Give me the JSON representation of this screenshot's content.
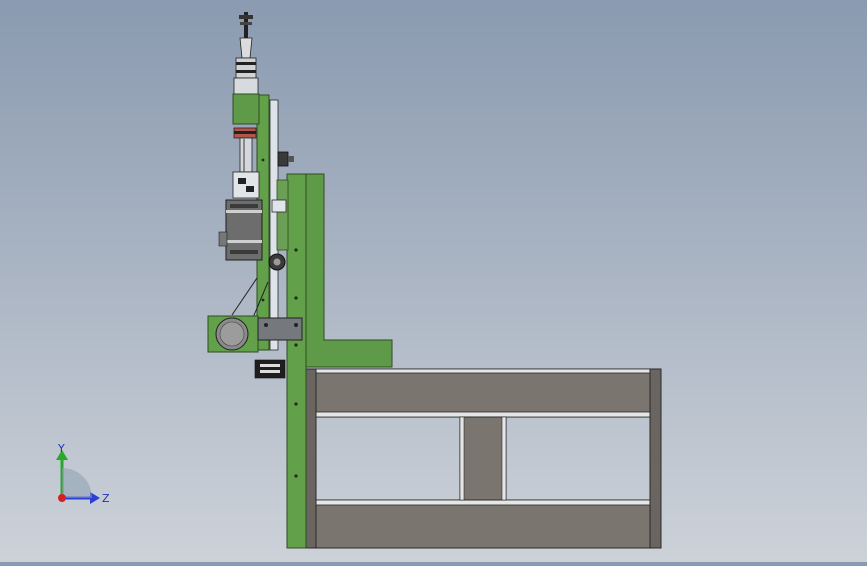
{
  "viewport": {
    "background_top": "#8a9ab0",
    "background_bottom": "#cdd2d9"
  },
  "model": {
    "frame_color": "#5f9a48",
    "frame_edge": "#2e4d22",
    "beam_color": "#7b756f",
    "beam_edge": "#2a2a2a",
    "motor_color": "#6d6d6d"
  },
  "triad": {
    "y_label": "Y",
    "z_label": "Z",
    "y_color": "#29a829",
    "z_color": "#2b3fd6",
    "origin_color": "#d42020"
  }
}
